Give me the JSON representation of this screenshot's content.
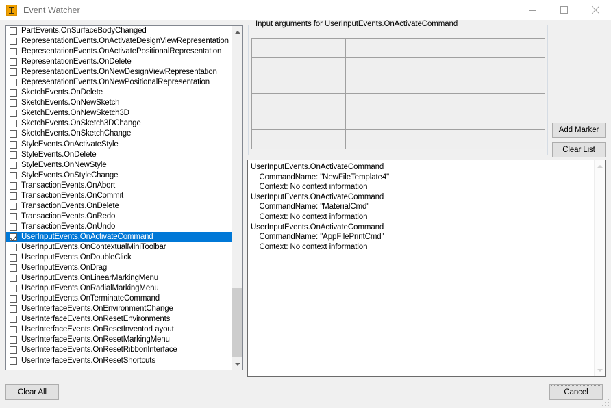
{
  "window": {
    "title": "Event Watcher",
    "icon": "inventor-app-icon",
    "controls": {
      "minimize": "minimize-icon",
      "maximize": "maximize-icon",
      "close": "close-icon"
    }
  },
  "accent_color": "#0078d7",
  "event_list": {
    "items": [
      {
        "label": "PartEvents.OnSurfaceBodyChanged",
        "checked": false,
        "selected": false
      },
      {
        "label": "RepresentationEvents.OnActivateDesignViewRepresentation",
        "checked": false,
        "selected": false
      },
      {
        "label": "RepresentationEvents.OnActivatePositionalRepresentation",
        "checked": false,
        "selected": false
      },
      {
        "label": "RepresentationEvents.OnDelete",
        "checked": false,
        "selected": false
      },
      {
        "label": "RepresentationEvents.OnNewDesignViewRepresentation",
        "checked": false,
        "selected": false
      },
      {
        "label": "RepresentationEvents.OnNewPositionalRepresentation",
        "checked": false,
        "selected": false
      },
      {
        "label": "SketchEvents.OnDelete",
        "checked": false,
        "selected": false
      },
      {
        "label": "SketchEvents.OnNewSketch",
        "checked": false,
        "selected": false
      },
      {
        "label": "SketchEvents.OnNewSketch3D",
        "checked": false,
        "selected": false
      },
      {
        "label": "SketchEvents.OnSketch3DChange",
        "checked": false,
        "selected": false
      },
      {
        "label": "SketchEvents.OnSketchChange",
        "checked": false,
        "selected": false
      },
      {
        "label": "StyleEvents.OnActivateStyle",
        "checked": false,
        "selected": false
      },
      {
        "label": "StyleEvents.OnDelete",
        "checked": false,
        "selected": false
      },
      {
        "label": "StyleEvents.OnNewStyle",
        "checked": false,
        "selected": false
      },
      {
        "label": "StyleEvents.OnStyleChange",
        "checked": false,
        "selected": false
      },
      {
        "label": "TransactionEvents.OnAbort",
        "checked": false,
        "selected": false
      },
      {
        "label": "TransactionEvents.OnCommit",
        "checked": false,
        "selected": false
      },
      {
        "label": "TransactionEvents.OnDelete",
        "checked": false,
        "selected": false
      },
      {
        "label": "TransactionEvents.OnRedo",
        "checked": false,
        "selected": false
      },
      {
        "label": "TransactionEvents.OnUndo",
        "checked": false,
        "selected": false
      },
      {
        "label": "UserInputEvents.OnActivateCommand",
        "checked": true,
        "selected": true
      },
      {
        "label": "UserInputEvents.OnContextualMiniToolbar",
        "checked": false,
        "selected": false
      },
      {
        "label": "UserInputEvents.OnDoubleClick",
        "checked": false,
        "selected": false
      },
      {
        "label": "UserInputEvents.OnDrag",
        "checked": false,
        "selected": false
      },
      {
        "label": "UserInputEvents.OnLinearMarkingMenu",
        "checked": false,
        "selected": false
      },
      {
        "label": "UserInputEvents.OnRadialMarkingMenu",
        "checked": false,
        "selected": false
      },
      {
        "label": "UserInputEvents.OnTerminateCommand",
        "checked": false,
        "selected": false
      },
      {
        "label": "UserInterfaceEvents.OnEnvironmentChange",
        "checked": false,
        "selected": false
      },
      {
        "label": "UserInterfaceEvents.OnResetEnvironments",
        "checked": false,
        "selected": false
      },
      {
        "label": "UserInterfaceEvents.OnResetInventorLayout",
        "checked": false,
        "selected": false
      },
      {
        "label": "UserInterfaceEvents.OnResetMarkingMenu",
        "checked": false,
        "selected": false
      },
      {
        "label": "UserInterfaceEvents.OnResetRibbonInterface",
        "checked": false,
        "selected": false
      },
      {
        "label": "UserInterfaceEvents.OnResetShortcuts",
        "checked": false,
        "selected": false
      }
    ],
    "scrollbar": {
      "up_arrow": "scroll-up-icon",
      "down_arrow": "scroll-down-icon",
      "thumb_position": "bottom"
    }
  },
  "input_arguments": {
    "title": "Input arguments for UserInputEvents.OnActivateCommand",
    "rows": [
      {
        "name": "",
        "value": ""
      },
      {
        "name": "",
        "value": ""
      },
      {
        "name": "",
        "value": ""
      },
      {
        "name": "",
        "value": ""
      },
      {
        "name": "",
        "value": ""
      },
      {
        "name": "",
        "value": ""
      }
    ]
  },
  "buttons": {
    "add_marker": "Add Marker",
    "clear_list": "Clear List",
    "clear_all": "Clear All",
    "cancel": "Cancel"
  },
  "log": {
    "text": "UserInputEvents.OnActivateCommand\n    CommandName: \"NewFileTemplate4\"\n    Context: No context information\nUserInputEvents.OnActivateCommand\n    CommandName: \"MaterialCmd\"\n    Context: No context information\nUserInputEvents.OnActivateCommand\n    CommandName: \"AppFilePrintCmd\"\n    Context: No context information"
  }
}
